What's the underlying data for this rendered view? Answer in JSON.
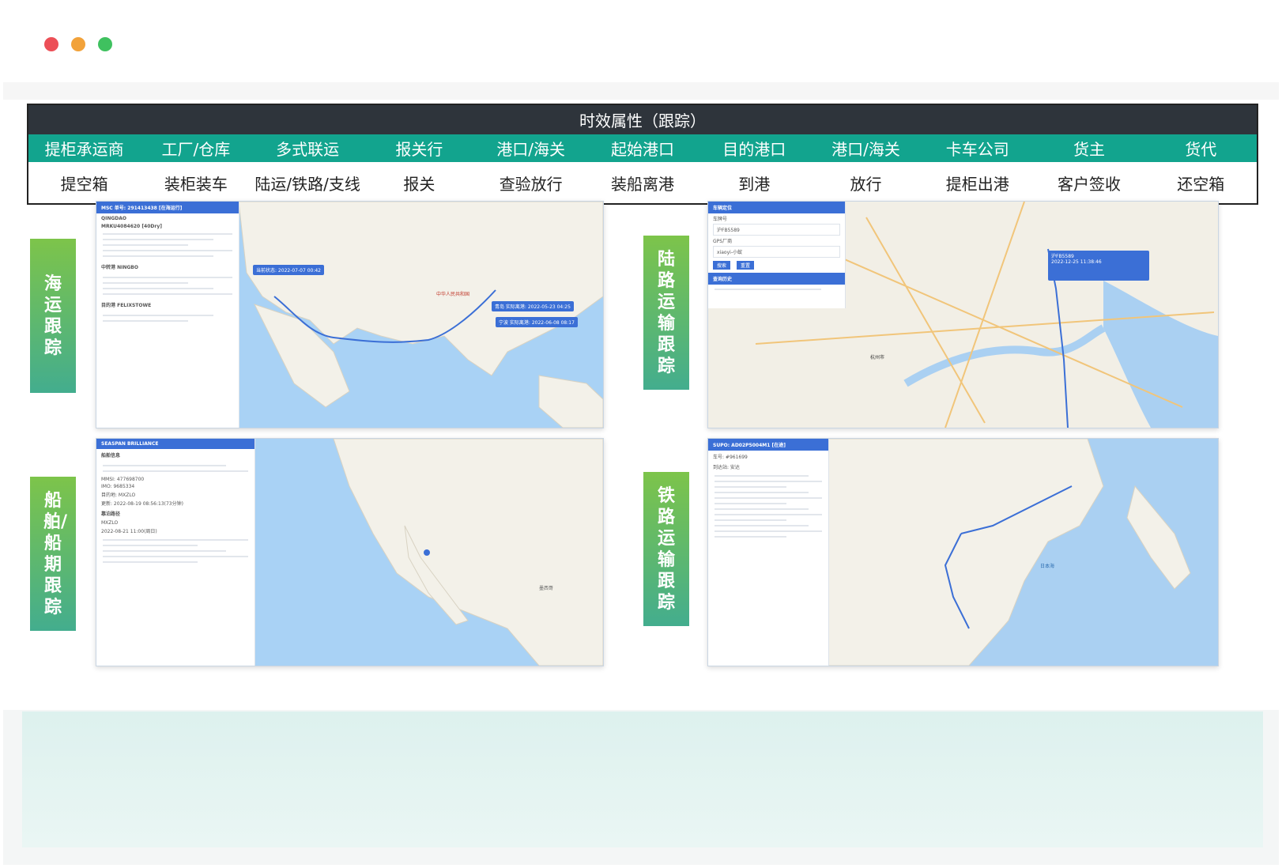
{
  "window": {
    "dots": {
      "red": "#ec4f57",
      "yellow": "#f2a23a",
      "green": "#3fc15f"
    }
  },
  "table": {
    "header": "时效属性（跟踪）",
    "roles": [
      "提柜承运商",
      "工厂/仓库",
      "多式联运",
      "报关行",
      "港口/海关",
      "起始港口",
      "目的港口",
      "港口/海关",
      "卡车公司",
      "货主",
      "货代"
    ],
    "steps": [
      "提空箱",
      "装柜装车",
      "陆运/铁路/支线",
      "报关",
      "查验放行",
      "装船离港",
      "到港",
      "放行",
      "提柜出港",
      "客户签收",
      "还空箱"
    ]
  },
  "labels": {
    "sea": "海运跟踪",
    "vessel": "船舶/船期跟踪",
    "road": "陆路运输跟踪",
    "rail": "铁路运输跟踪"
  },
  "screens": {
    "sea": {
      "panel_title": "MSC 单号: 291413438 [在海运行]",
      "container": "MRKU4084620 [40Dry]",
      "pol": "QINGDAO",
      "pod": "FELIXSTOWE",
      "transship": "中转港 NINGBO",
      "arrival": "目的港 FELIXSTOWE",
      "tag1": "当前状态: 2022-07-07 00:42",
      "tag2": "青岛 实际离港: 2022-05-23 04:25",
      "tag3": "宁波 实际离港: 2022-06-08 08:17",
      "map_label": "中华人民共和国"
    },
    "vessel": {
      "panel_title": "SEASPAN BRILLIANCE",
      "section": "船舶信息",
      "mmsi": "MMSI: 477698700",
      "imo": "IMO: 9685334",
      "dest": "目的地: MXZLO",
      "updated": "更新: 2022-08-19 08:56:13(73分钟)",
      "route": "靠泊路径",
      "port": "MXZLO",
      "eta": "2022-08-21 11:00(周日)",
      "map_label": "墨西哥"
    },
    "road": {
      "panel_title": "车辆定位",
      "plate_label": "车牌号",
      "plate": "沪FB5589",
      "gps_label": "GPS厂商",
      "gps": "xiaoyi-小蚁",
      "search_btn": "搜索",
      "reset_btn": "重置",
      "history": "查询历史",
      "popup_plate": "沪FB5589",
      "popup_time": "2022-12-25 11:38:46",
      "city": "杭州市"
    },
    "rail": {
      "panel_title": "SUPO: AD02P5004M1 [在途]",
      "car": "车号: #961699",
      "station": "到达站: 安达",
      "map_label": "日本海"
    }
  }
}
